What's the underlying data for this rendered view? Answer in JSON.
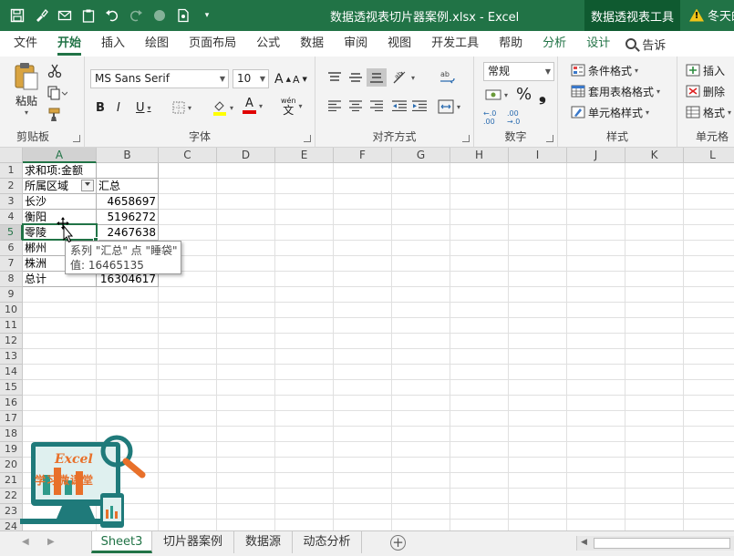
{
  "title_bar": {
    "document_title": "数据透视表切片器案例.xlsx  -  Excel",
    "context_title": "数据透视表工具",
    "warning_text": "冬天的",
    "qat_icons": [
      "save-icon",
      "brush-icon",
      "email-icon",
      "clipboard-icon",
      "undo-icon",
      "redo-icon",
      "record-icon",
      "document-icon",
      "qat-dropdown-icon"
    ]
  },
  "ribbon_tabs": {
    "items": [
      "文件",
      "开始",
      "插入",
      "绘图",
      "页面布局",
      "公式",
      "数据",
      "审阅",
      "视图",
      "开发工具",
      "帮助",
      "分析",
      "设计"
    ],
    "active": "开始",
    "search": "告诉"
  },
  "ribbon": {
    "clipboard": {
      "paste": "粘贴",
      "label": "剪贴板"
    },
    "font": {
      "name": "MS Sans Serif",
      "size": "10",
      "bold": "B",
      "italic": "I",
      "underline": "U",
      "label": "字体",
      "grow": "A",
      "shrink": "A",
      "font_color": "A",
      "phonetic": "wén",
      "phonetic_char": "文"
    },
    "alignment": {
      "label": "对齐方式"
    },
    "number": {
      "format": "常规",
      "percent": "%",
      "comma": "❟",
      "label": "数字",
      "inc": "←.0 .00",
      "dec": ".00 →.0"
    },
    "styles": {
      "conditional": "条件格式",
      "table": "套用表格格式",
      "cell": "单元格样式",
      "label": "样式"
    },
    "cells": {
      "insert": "插入",
      "delete": "删除",
      "format": "格式",
      "label": "单元格"
    }
  },
  "sheet": {
    "columns": [
      "A",
      "B",
      "C",
      "D",
      "E",
      "F",
      "G",
      "H",
      "I",
      "J",
      "K",
      "L"
    ],
    "rows": [
      "1",
      "2",
      "3",
      "4",
      "5",
      "6",
      "7",
      "8",
      "9",
      "10",
      "11",
      "12",
      "13",
      "14",
      "15",
      "16",
      "17",
      "18",
      "19",
      "20",
      "21",
      "22",
      "23",
      "24"
    ],
    "selected_cell": "A5",
    "cells": {
      "A1": "求和项:金额",
      "A2": "所属区域",
      "B2": "汇总",
      "A3": "长沙",
      "B3": "4658697",
      "A4": "衡阳",
      "B4": "5196272",
      "A5": "零陵",
      "B5": "2467638",
      "A6": "郴州",
      "A7": "株洲",
      "A8": "总计",
      "B8": "16304617"
    }
  },
  "tooltip": {
    "line1": "系列 \"汇总\" 点 \"睡袋\"",
    "line2": "值: 16465135"
  },
  "logo": {
    "title": "Excel",
    "subtitle": "学习微课堂"
  },
  "sheet_tabs": {
    "items": [
      "Sheet3",
      "切片器案例",
      "数据源",
      "动态分析"
    ],
    "active": "Sheet3"
  },
  "colors": {
    "accent": "#217346",
    "context_bg": "#0f5a30",
    "logo_teal": "#1f7a7a",
    "logo_orange": "#e8702a"
  }
}
